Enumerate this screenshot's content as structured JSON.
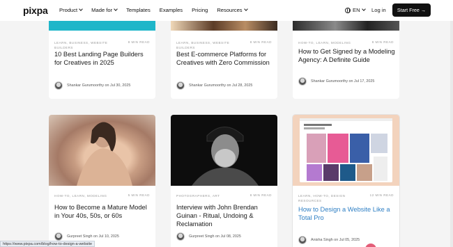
{
  "nav": {
    "logo": "pixpa",
    "menu": [
      "Product",
      "Made for",
      "Templates",
      "Examples",
      "Pricing",
      "Resources"
    ],
    "lang": "EN",
    "login": "Log in",
    "cta": "Start Free →"
  },
  "row1": [
    {
      "tags": "LEARN, BUSINESS, WEBSITE BUILDERS",
      "read": "8 MIN READ",
      "title": "10 Best Landing Page Builders for Creatives in 2025",
      "author": "Shankar Gurumoorthy on Jul 30, 2025"
    },
    {
      "tags": "LEARN, BUSINESS, WEBSITE BUILDERS",
      "read": "8 MIN READ",
      "title": "Best E-commerce Platforms for Creatives with Zero Commission",
      "author": "Shankar Gurumoorthy on Jul 28, 2025"
    },
    {
      "tags": "HOW-TO, LEARN, MODELING",
      "read": "8 MIN READ",
      "title": "How to Get Signed by a Modeling Agency: A Definite Guide",
      "author": "Shankar Gurumoorthy on Jul 17, 2025"
    }
  ],
  "row2": [
    {
      "tags": "HOW-TO, LEARN, MODELING",
      "read": "5 MIN READ",
      "title": "How to Become a Mature Model in Your 40s, 50s, or 60s",
      "author": "Gurpreet Singh on Jul 10, 2025"
    },
    {
      "tags": "PHOTOGRAPHERS, ART",
      "read": "8 MIN READ",
      "title": "Interview with John Brendan Guinan - Ritual, Undoing & Reclamation",
      "author": "Gurpreet Singh on Jul 08, 2025"
    },
    {
      "tags": "LEARN, HOW-TO, DESIGN RESOURCES",
      "read": "12 MIN READ",
      "title": "How to Design a Website Like a Total Pro",
      "author": "Anisha Singh on Jul 05, 2025"
    }
  ],
  "status_url": "https://www.pixpa.com/blog/how-to-design-a-website",
  "colors": {
    "accent_link": "#2f7fc4",
    "cta_bg": "#111111"
  }
}
